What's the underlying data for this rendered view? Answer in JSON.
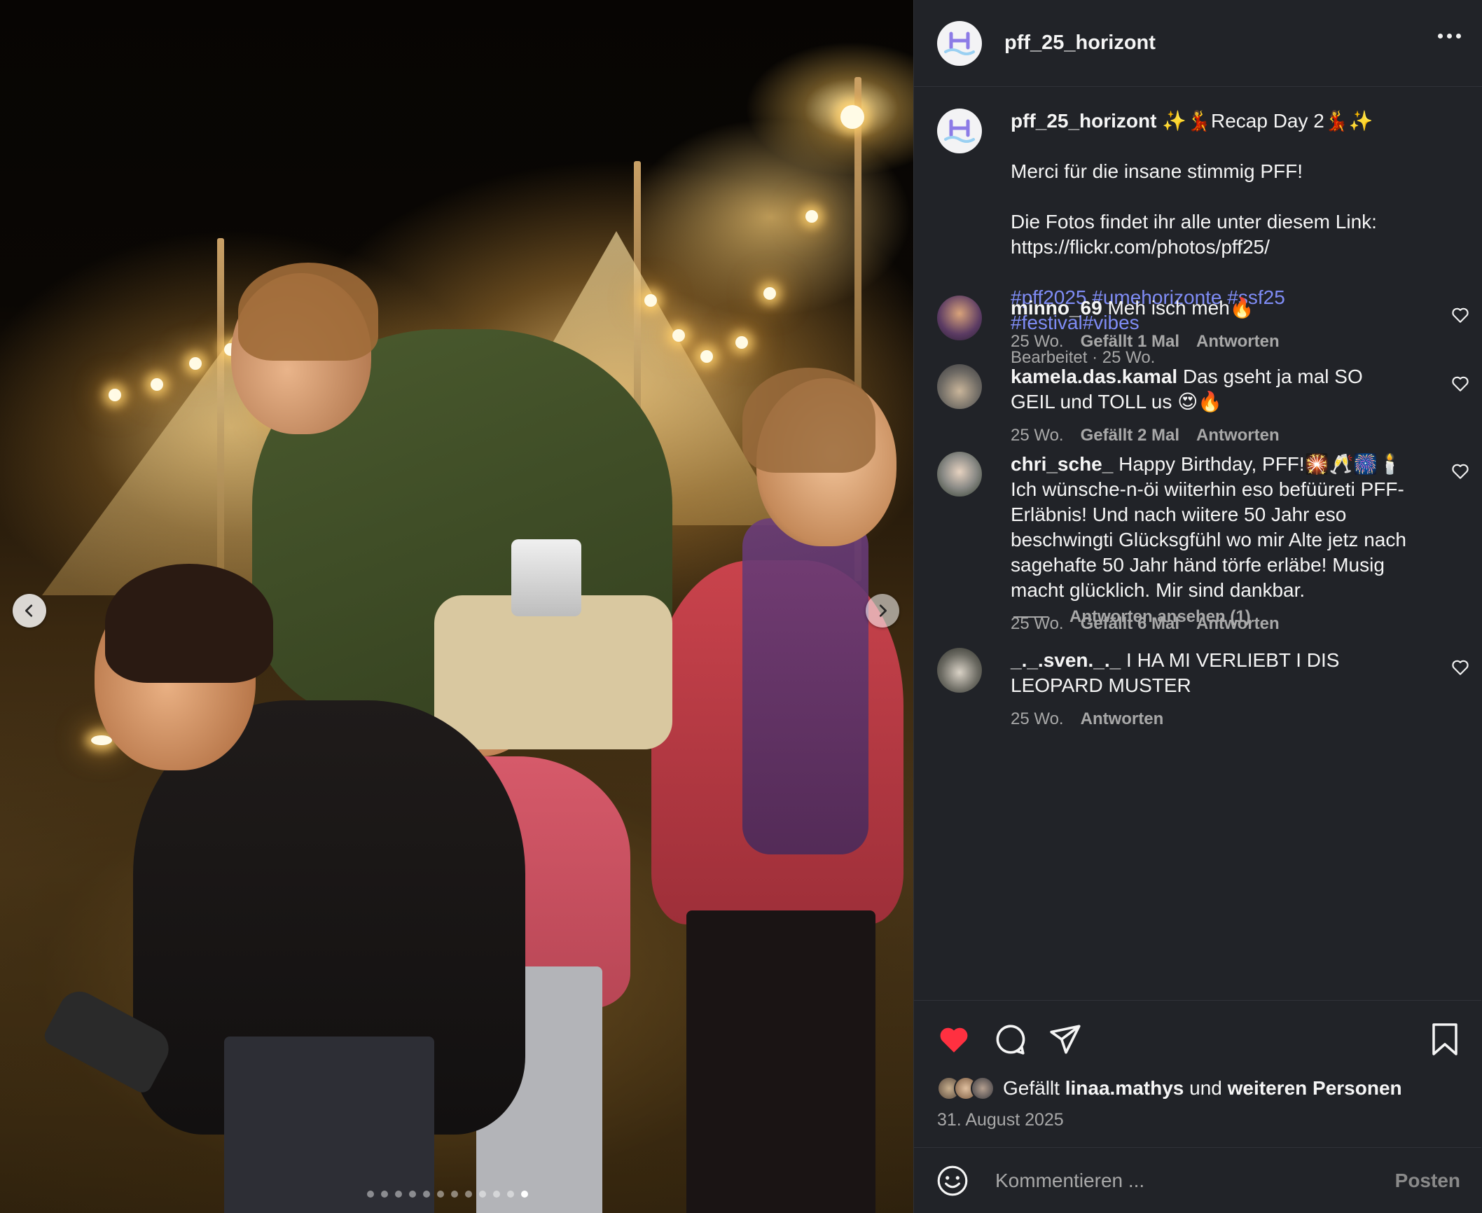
{
  "post": {
    "username": "pff_25_horizont",
    "avatar_letter": "H",
    "more_icon": "more-horizontal-icon"
  },
  "media": {
    "slide_count": 12,
    "active_slide": 11,
    "prev_icon": "chevron-left-icon",
    "next_icon": "chevron-right-icon",
    "accent_color": "#0095f6"
  },
  "caption": {
    "username": "pff_25_horizont",
    "title": "✨💃Recap Day 2💃✨",
    "line1": "Merci für die insane stimmig PFF!",
    "line2": "Die Fotos findet ihr alle unter diesem Link:",
    "link": "https://flickr.com/photos/pff25/",
    "hashtags_line1": "#pff2025 #umehorizonte #ssf25",
    "hashtags_line2": "#festival#vibes",
    "meta": "Bearbeitet · 25 Wo."
  },
  "comments": [
    {
      "username": "minno_69",
      "text": "Meh isch meh🔥",
      "time": "25 Wo.",
      "likes": "Gefällt 1 Mal",
      "reply": "Antworten"
    },
    {
      "username": "kamela.das.kamal",
      "text": "Das gseht ja mal SO GEIL und TOLL us 😍🔥",
      "time": "25 Wo.",
      "likes": "Gefällt 2 Mal",
      "reply": "Antworten"
    },
    {
      "username": "chri_sche_",
      "text": "Happy Birthday, PFF!🎇🥂🎆🕯️Ich wünsche-n-öi wiiterhin eso befüüreti PFF-Erläbnis! Und nach wiitere 50 Jahr eso beschwingti Glücksgfühl wo mir Alte jetz nach sagehafte 50 Jahr händ törfe erläbe! Musig macht glücklich. Mir sind dankbar.",
      "time": "25 Wo.",
      "likes": "Gefällt 6 Mal",
      "reply": "Antworten",
      "view_replies": "Antworten ansehen (1)"
    },
    {
      "username": "_._.sven._._",
      "text": "I HA MI VERLIEBT I DIS LEOPARD MUSTER",
      "time": "25 Wo.",
      "reply": "Antworten"
    }
  ],
  "actions": {
    "like_icon": "heart-filled-icon",
    "comment_icon": "comment-icon",
    "share_icon": "send-icon",
    "save_icon": "bookmark-icon",
    "like_color": "#ff3040",
    "likes_prefix": "Gefällt",
    "likes_user": "linaa.mathys",
    "likes_middle": "und",
    "likes_rest": "weiteren Personen",
    "date": "31. August 2025"
  },
  "comment_input": {
    "emoji_icon": "emoji-smile-icon",
    "placeholder": "Kommentieren ...",
    "post_label": "Posten"
  }
}
